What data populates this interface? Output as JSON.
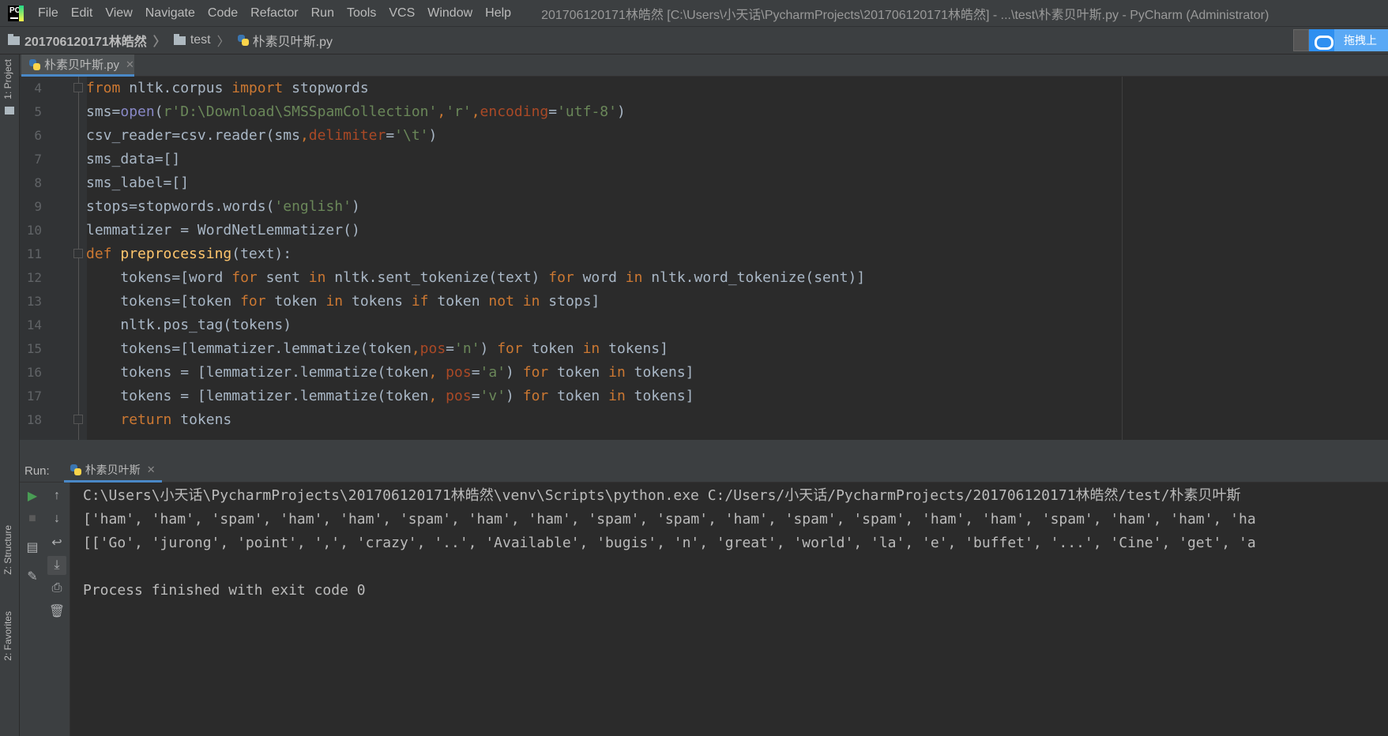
{
  "menubar": {
    "items": [
      "File",
      "Edit",
      "View",
      "Navigate",
      "Code",
      "Refactor",
      "Run",
      "Tools",
      "VCS",
      "Window",
      "Help"
    ],
    "window_title": "201706120171林皓然 [C:\\Users\\小天话\\PycharmProjects\\201706120171林皓然] - ...\\test\\朴素贝叶斯.py - PyCharm (Administrator)"
  },
  "breadcrumb": {
    "project": "201706120171林皓然",
    "folder": "test",
    "file": "朴素贝叶斯.py"
  },
  "cloud_widget": {
    "label": "拖拽上"
  },
  "left_strip": {
    "project_tab": "1: Project",
    "structure_tab": "Z: Structure",
    "favorites_tab": "2: Favorites"
  },
  "editor": {
    "tab_label": "朴素贝叶斯.py",
    "line_numbers": [
      "4",
      "5",
      "6",
      "7",
      "8",
      "9",
      "10",
      "11",
      "12",
      "13",
      "14",
      "15",
      "16",
      "17",
      "18"
    ],
    "lines": [
      "from nltk.corpus import stopwords",
      "sms=open(r'D:\\Download\\SMSSpamCollection','r',encoding='utf-8')",
      "csv_reader=csv.reader(sms,delimiter='\\t')",
      "sms_data=[]",
      "sms_label=[]",
      "stops=stopwords.words('english')",
      "lemmatizer = WordNetLemmatizer()",
      "def preprocessing(text):",
      "    tokens=[word for sent in nltk.sent_tokenize(text) for word in nltk.word_tokenize(sent)]",
      "    tokens=[token for token in tokens if token not in stops]",
      "    nltk.pos_tag(tokens)",
      "    tokens=[lemmatizer.lemmatize(token,pos='n') for token in tokens]",
      "    tokens = [lemmatizer.lemmatize(token, pos='a') for token in tokens]",
      "    tokens = [lemmatizer.lemmatize(token, pos='v') for token in tokens]",
      "    return tokens"
    ]
  },
  "run_panel": {
    "label": "Run:",
    "tab_label": "朴素贝叶斯",
    "console_lines": [
      "C:\\Users\\小天话\\PycharmProjects\\201706120171林皓然\\venv\\Scripts\\python.exe C:/Users/小天话/PycharmProjects/201706120171林皓然/test/朴素贝叶斯",
      "['ham', 'ham', 'spam', 'ham', 'ham', 'spam', 'ham', 'ham', 'spam', 'spam', 'ham', 'spam', 'spam', 'ham', 'ham', 'spam', 'ham', 'ham', 'ha",
      "[['Go', 'jurong', 'point', ',', 'crazy', '..', 'Available', 'bugis', 'n', 'great', 'world', 'la', 'e', 'buffet', '...', 'Cine', 'get', 'a",
      "",
      "Process finished with exit code 0"
    ]
  },
  "colors": {
    "keyword": "#cc7832",
    "string": "#6a8759",
    "parameter": "#aa4926",
    "builtin": "#8888c6",
    "function": "#ffc66d",
    "default_text": "#a9b7c6",
    "accent": "#4a88c7"
  },
  "icons": [
    "pycharm-logo-icon",
    "folder-icon",
    "python-file-icon",
    "baidu-cloud-icon",
    "run-icon",
    "stop-icon",
    "up-arrow-icon",
    "down-arrow-icon",
    "soft-wrap-icon",
    "scroll-to-end-icon",
    "print-icon",
    "trash-icon",
    "layout-icon",
    "pin-icon"
  ]
}
